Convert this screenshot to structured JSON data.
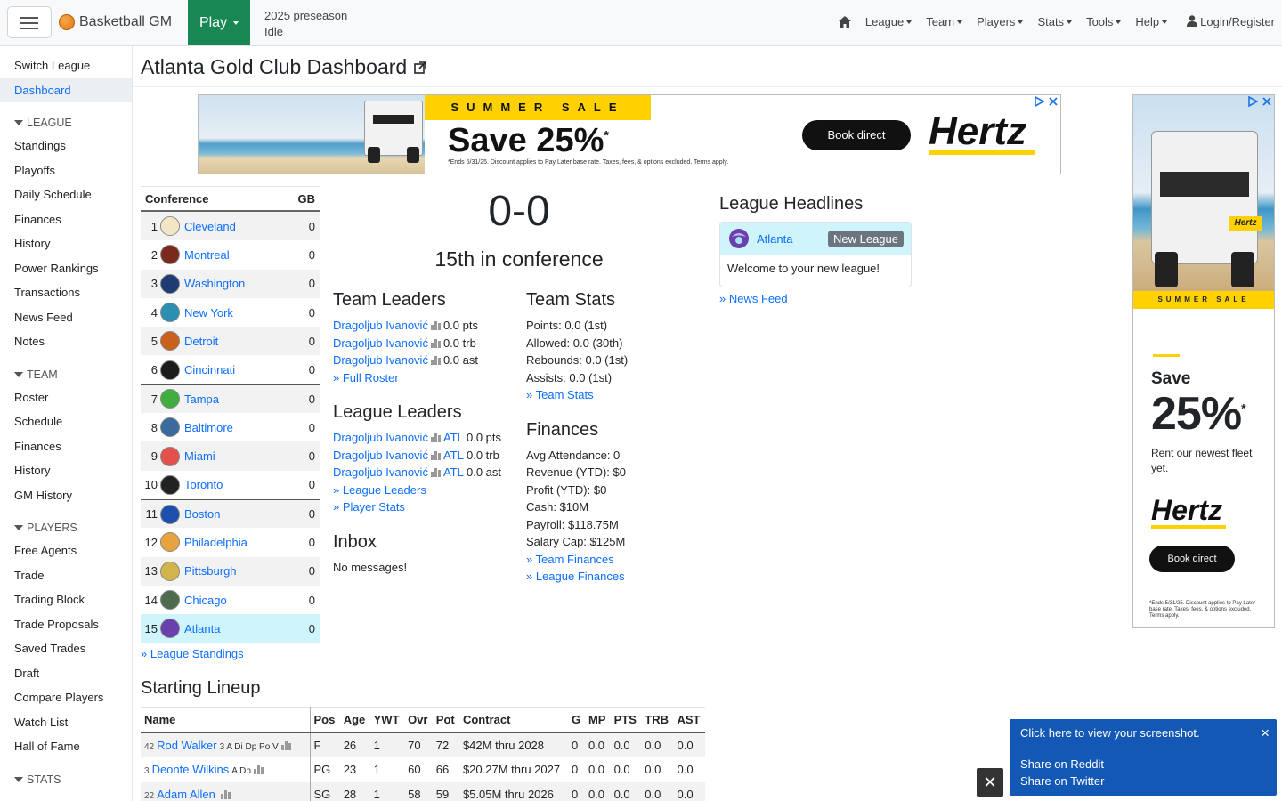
{
  "navbar": {
    "brand": "Basketball GM",
    "play": "Play",
    "status_line1": "2025 preseason",
    "status_line2": "Idle",
    "menus": [
      "League",
      "Team",
      "Players",
      "Stats",
      "Tools",
      "Help"
    ],
    "login": "Login/Register"
  },
  "sidebar": {
    "top": [
      "Switch League",
      "Dashboard"
    ],
    "league_head": "LEAGUE",
    "league": [
      "Standings",
      "Playoffs",
      "Daily Schedule",
      "Finances",
      "History",
      "Power Rankings",
      "Transactions",
      "News Feed",
      "Notes"
    ],
    "team_head": "TEAM",
    "team": [
      "Roster",
      "Schedule",
      "Finances",
      "History",
      "GM History"
    ],
    "players_head": "PLAYERS",
    "players": [
      "Free Agents",
      "Trade",
      "Trading Block",
      "Trade Proposals",
      "Saved Trades",
      "Draft",
      "Compare Players",
      "Watch List",
      "Hall of Fame"
    ],
    "stats_head": "STATS"
  },
  "page": {
    "title": "Atlanta Gold Club Dashboard"
  },
  "ad_top": {
    "sale": "SUMMER SALE",
    "save": "Save 25%",
    "star": "*",
    "fine": "*Ends 5/31/25. Discount applies to Pay Later base rate. Taxes, fees, & options excluded. Terms apply.",
    "book": "Book direct",
    "brand": "Hertz"
  },
  "ad_side": {
    "sale": "SUMMER SALE",
    "save": "Save",
    "pct": "25%",
    "star": "*",
    "rent": "Rent our newest fleet yet.",
    "brand": "Hertz",
    "book": "Book direct",
    "fine": "*Ends 5/31/25. Discount applies to Pay Later base rate. Taxes, fees, & options excluded. Terms apply."
  },
  "conference": {
    "head_name": "Conference",
    "head_gb": "GB",
    "rows": [
      {
        "rank": "1",
        "team": "Cleveland",
        "gb": "0",
        "color": "#f3e6c4"
      },
      {
        "rank": "2",
        "team": "Montreal",
        "gb": "0",
        "color": "#7a2a1c"
      },
      {
        "rank": "3",
        "team": "Washington",
        "gb": "0",
        "color": "#1f3b73"
      },
      {
        "rank": "4",
        "team": "New York",
        "gb": "0",
        "color": "#2b8fb0"
      },
      {
        "rank": "5",
        "team": "Detroit",
        "gb": "0",
        "color": "#c9601c"
      },
      {
        "rank": "6",
        "team": "Cincinnati",
        "gb": "0",
        "color": "#1c1c1c"
      },
      {
        "rank": "7",
        "team": "Tampa",
        "gb": "0",
        "color": "#3fae3f"
      },
      {
        "rank": "8",
        "team": "Baltimore",
        "gb": "0",
        "color": "#3a6b9c"
      },
      {
        "rank": "9",
        "team": "Miami",
        "gb": "0",
        "color": "#e4504c"
      },
      {
        "rank": "10",
        "team": "Toronto",
        "gb": "0",
        "color": "#222222"
      },
      {
        "rank": "11",
        "team": "Boston",
        "gb": "0",
        "color": "#1d4fae"
      },
      {
        "rank": "12",
        "team": "Philadelphia",
        "gb": "0",
        "color": "#e7a33c"
      },
      {
        "rank": "13",
        "team": "Pittsburgh",
        "gb": "0",
        "color": "#d2b54a"
      },
      {
        "rank": "14",
        "team": "Chicago",
        "gb": "0",
        "color": "#4d6b4d"
      },
      {
        "rank": "15",
        "team": "Atlanta",
        "gb": "0",
        "color": "#6a3fae"
      }
    ],
    "link": "» League Standings"
  },
  "record": {
    "wl": "0-0",
    "rank": "15th in conference"
  },
  "team_leaders": {
    "title": "Team Leaders",
    "rows": [
      {
        "name": "Dragoljub Ivanović",
        "stat": "0.0 pts"
      },
      {
        "name": "Dragoljub Ivanović",
        "stat": "0.0 trb"
      },
      {
        "name": "Dragoljub Ivanović",
        "stat": "0.0 ast"
      }
    ],
    "link": "» Full Roster"
  },
  "league_leaders": {
    "title": "League Leaders",
    "rows": [
      {
        "name": "Dragoljub Ivanović",
        "team": "ATL",
        "stat": "0.0 pts"
      },
      {
        "name": "Dragoljub Ivanović",
        "team": "ATL",
        "stat": "0.0 trb"
      },
      {
        "name": "Dragoljub Ivanović",
        "team": "ATL",
        "stat": "0.0 ast"
      }
    ],
    "link1": "» League Leaders",
    "link2": "» Player Stats"
  },
  "inbox": {
    "title": "Inbox",
    "text": "No messages!"
  },
  "team_stats": {
    "title": "Team Stats",
    "rows": [
      "Points: 0.0 (1st)",
      "Allowed: 0.0 (30th)",
      "Rebounds: 0.0 (1st)",
      "Assists: 0.0 (1st)"
    ],
    "link": "» Team Stats"
  },
  "finances": {
    "title": "Finances",
    "rows": [
      "Avg Attendance: 0",
      "Revenue (YTD): $0",
      "Profit (YTD): $0",
      "Cash: $10M",
      "Payroll: $118.75M",
      "Salary Cap: $125M"
    ],
    "link1": "» Team Finances",
    "link2": "» League Finances"
  },
  "headlines": {
    "title": "League Headlines",
    "team": "Atlanta",
    "badge": "New League",
    "text": "Welcome to your new league!",
    "link": "» News Feed"
  },
  "lineup": {
    "title": "Starting Lineup",
    "cols": [
      "Name",
      "Pos",
      "Age",
      "YWT",
      "Ovr",
      "Pot",
      "Contract",
      "G",
      "MP",
      "PTS",
      "TRB",
      "AST"
    ],
    "rows": [
      {
        "num": "42",
        "name": "Rod Walker",
        "skills": "3 A Di Dp Po V",
        "pos": "F",
        "age": "26",
        "ywt": "1",
        "ovr": "70",
        "pot": "72",
        "contract": "$42M thru 2028",
        "g": "0",
        "mp": "0.0",
        "pts": "0.0",
        "trb": "0.0",
        "ast": "0.0"
      },
      {
        "num": "3",
        "name": "Deonte Wilkins",
        "skills": "A Dp",
        "pos": "PG",
        "age": "23",
        "ywt": "1",
        "ovr": "60",
        "pot": "66",
        "contract": "$20.27M thru 2027",
        "g": "0",
        "mp": "0.0",
        "pts": "0.0",
        "trb": "0.0",
        "ast": "0.0"
      },
      {
        "num": "22",
        "name": "Adam Allen",
        "skills": "",
        "pos": "SG",
        "age": "28",
        "ywt": "1",
        "ovr": "58",
        "pot": "59",
        "contract": "$5.05M thru 2026",
        "g": "0",
        "mp": "0.0",
        "pts": "0.0",
        "trb": "0.0",
        "ast": "0.0"
      }
    ]
  },
  "notification": {
    "line1": "Click here to view your screenshot.",
    "line2": "Share on Reddit",
    "line3": "Share on Twitter",
    "close": "×",
    "close_box": "✕"
  },
  "colors": {
    "play": "#198754",
    "link": "#0d6efd",
    "user_row": "#cff4fc",
    "ad_yellow": "#ffd100"
  }
}
